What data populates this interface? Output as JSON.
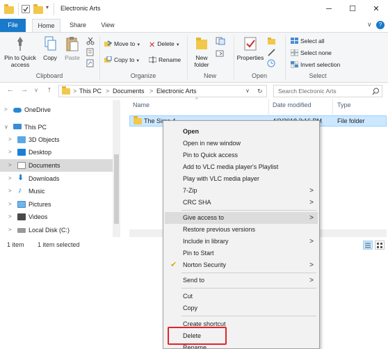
{
  "window": {
    "title": "Electronic Arts",
    "controls": {
      "minimize": "─",
      "maximize": "☐",
      "close": "✕"
    }
  },
  "tabs": [
    {
      "label": "File"
    },
    {
      "label": "Home"
    },
    {
      "label": "Share"
    },
    {
      "label": "View"
    }
  ],
  "ribbon": {
    "clipboard": {
      "pin": "Pin to Quick access",
      "copy": "Copy",
      "paste": "Paste",
      "group": "Clipboard"
    },
    "organize": {
      "move_to": "Move to",
      "copy_to": "Copy to",
      "delete": "Delete",
      "rename": "Rename",
      "group": "Organize"
    },
    "new": {
      "new_folder": "New folder",
      "group": "New"
    },
    "open": {
      "properties": "Properties",
      "group": "Open"
    },
    "select": {
      "select_all": "Select all",
      "select_none": "Select none",
      "invert": "Invert selection",
      "group": "Select"
    }
  },
  "address": {
    "crumbs": [
      "This PC",
      "Documents",
      "Electronic Arts"
    ],
    "search_placeholder": "Search Electronic Arts"
  },
  "nav": {
    "items": [
      {
        "label": "OneDrive"
      },
      {
        "label": "This PC"
      },
      {
        "label": "3D Objects"
      },
      {
        "label": "Desktop"
      },
      {
        "label": "Documents"
      },
      {
        "label": "Downloads"
      },
      {
        "label": "Music"
      },
      {
        "label": "Pictures"
      },
      {
        "label": "Videos"
      },
      {
        "label": "Local Disk (C:)"
      }
    ]
  },
  "columns": {
    "name": "Name",
    "date": "Date modified",
    "type": "Type"
  },
  "files": [
    {
      "name": "The Sims 4",
      "date": "4/3/2018 3:16 PM",
      "type": "File folder"
    }
  ],
  "status": {
    "count": "1 item",
    "selected": "1 item selected"
  },
  "context_menu": {
    "items": [
      {
        "label": "Open"
      },
      {
        "label": "Open in new window"
      },
      {
        "label": "Pin to Quick access"
      },
      {
        "label": "Add to VLC media player's Playlist"
      },
      {
        "label": "Play with VLC media player"
      },
      {
        "label": "7-Zip"
      },
      {
        "label": "CRC SHA"
      },
      {
        "label": "Give access to"
      },
      {
        "label": "Restore previous versions"
      },
      {
        "label": "Include in library"
      },
      {
        "label": "Pin to Start"
      },
      {
        "label": "Norton Security"
      },
      {
        "label": "Send to"
      },
      {
        "label": "Cut"
      },
      {
        "label": "Copy"
      },
      {
        "label": "Create shortcut"
      },
      {
        "label": "Delete"
      },
      {
        "label": "Rename"
      }
    ],
    "submenu_arrow": ">"
  },
  "glyphs": {
    "back": "←",
    "forward": "→",
    "dropdown": "∨",
    "up": "↑",
    "chevron_right": ">",
    "chevron_down": "∨",
    "check": "✔",
    "sort_up": "^"
  },
  "colors": {
    "accent": "#1979ca",
    "selection": "#cce8ff",
    "highlight_box": "#e0242a",
    "folder": "#f1c84a"
  }
}
